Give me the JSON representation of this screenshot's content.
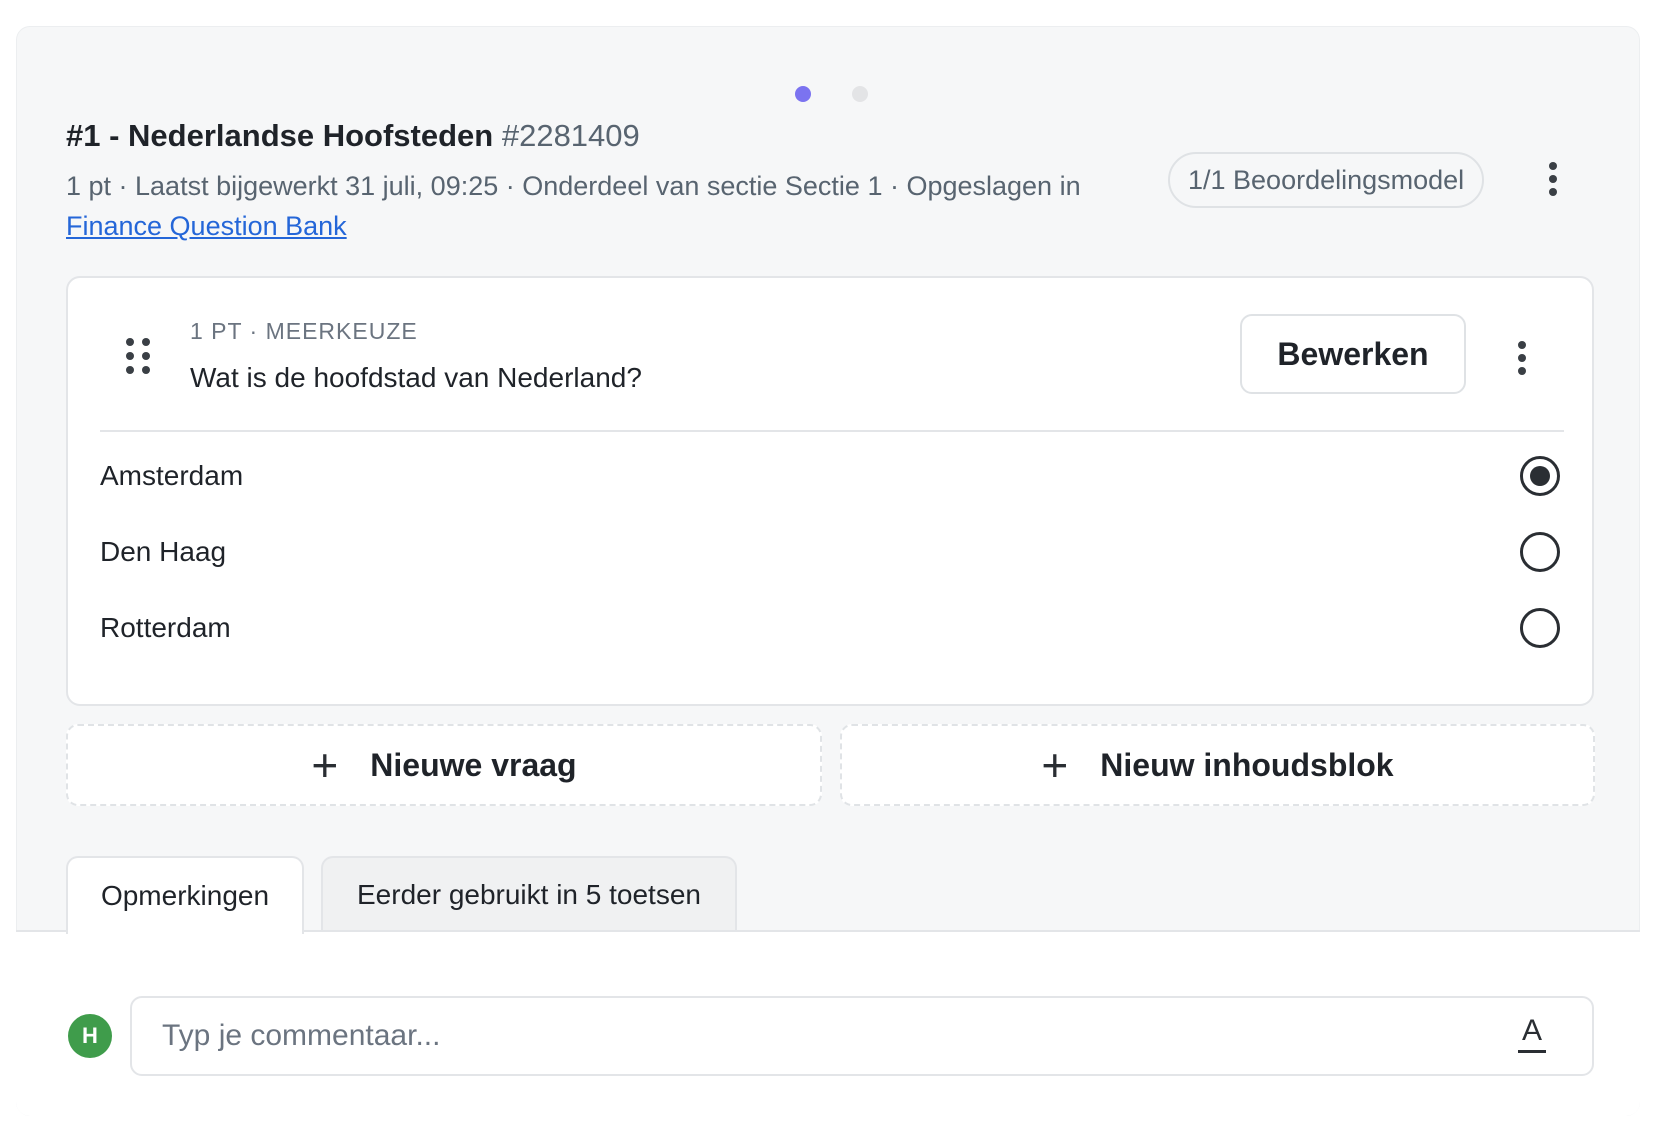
{
  "pager": {
    "count": 2,
    "active_index": 0,
    "active_color": "#7b73f0"
  },
  "question": {
    "title": "#1 - Nederlandse Hoofsteden",
    "id": "#2281409",
    "meta_text": "1 pt · Laatst bijgewerkt 31 juli, 09:25 · Onderdeel van sectie Sectie 1 · Opgeslagen in",
    "bank_link": "Finance Question Bank",
    "model_pill": "1/1 Beoordelingsmodel"
  },
  "card": {
    "type_label": "1 PT · MEERKEUZE",
    "question_text": "Wat is de hoofdstad van Nederland?",
    "edit_label": "Bewerken",
    "options": [
      {
        "label": "Amsterdam",
        "selected": true
      },
      {
        "label": "Den Haag",
        "selected": false
      },
      {
        "label": "Rotterdam",
        "selected": false
      }
    ]
  },
  "actions": {
    "new_question": "Nieuwe vraag",
    "new_content_block": "Nieuw inhoudsblok"
  },
  "tabs": [
    {
      "label": "Opmerkingen",
      "active": true
    },
    {
      "label": "Eerder gebruikt in 5 toetsen",
      "active": false
    }
  ],
  "comments": {
    "avatar_initial": "H",
    "avatar_color": "#3f9c4b",
    "placeholder": "Typ je commentaar...",
    "format_icon_glyph": "A"
  }
}
